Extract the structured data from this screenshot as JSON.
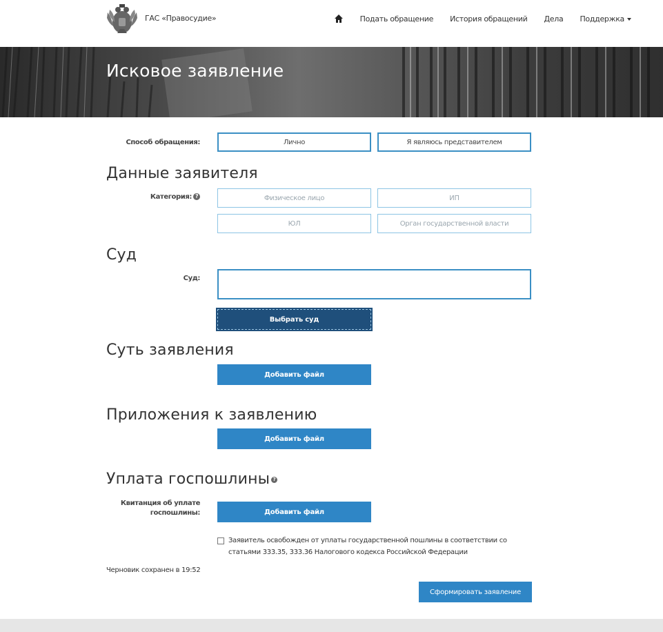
{
  "header": {
    "brand": "ГАС «Правосудие»",
    "nav": {
      "submit": "Подать обращение",
      "history": "История обращений",
      "cases": "Дела",
      "support": "Поддержка"
    }
  },
  "banner": {
    "title": "Исковое заявление"
  },
  "form": {
    "method": {
      "label": "Способ обращения:",
      "options": [
        "Лично",
        "Я являюсь представителем"
      ]
    },
    "applicant": {
      "title": "Данные заявителя",
      "category_label": "Категория:",
      "options": [
        "Физическое лицо",
        "ИП",
        "ЮЛ",
        "Орган государственной власти"
      ]
    },
    "court": {
      "title": "Суд",
      "label": "Суд:",
      "value": "",
      "select_button": "Выбрать суд"
    },
    "essence": {
      "title": "Суть заявления",
      "add_file": "Добавить файл"
    },
    "attachments": {
      "title": "Приложения к заявлению",
      "add_file": "Добавить файл"
    },
    "fee": {
      "title": "Уплата госпошлины",
      "receipt_label_line1": "Квитанция об уплате",
      "receipt_label_line2": "госпошлины:",
      "add_file": "Добавить файл",
      "exempt_text": "Заявитель освобожден от уплаты государственной пошлины в соответствии со статьями 333.35, 333.36 Налогового кодекса Российской Федерации",
      "exempt_checked": false
    },
    "draft_status": "Черновик сохранен в 19:52",
    "submit_button": "Сформировать заявление"
  },
  "colors": {
    "accent": "#2f86c6",
    "accent_dark": "#1f4f7b",
    "border": "#3a8fc4"
  }
}
